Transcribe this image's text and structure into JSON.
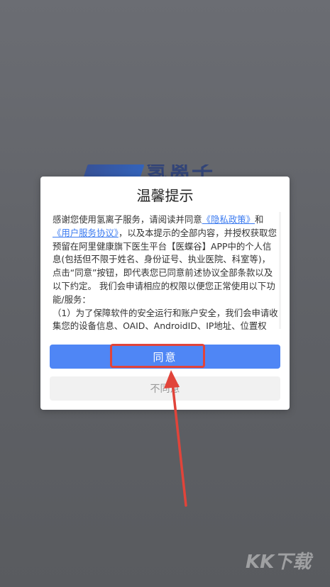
{
  "background": {
    "logo_text": "氢离子"
  },
  "dialog": {
    "title": "温馨提示",
    "body": {
      "line1_prefix": "感谢您使用氢离子服务，请阅读并同意",
      "privacy_link": "《隐私政策》",
      "and": "和",
      "user_agreement_link": "《用户服务协议》",
      "rest": "，以及本提示的全部内容，并授权获取您预留在阿里健康旗下医生平台【医蝶谷】APP中的个人信息(包括但不限于姓名、身份证号、执业医院、科室等)，点击“同意”按钮，即代表您已同意前述协议全部条款以及以下约定。 我们会申请相应的权限以便您正常使用以下功能/服务：",
      "item1": "（1）为了保障软件的安全运行和账户安全，我们会申请收集您的设备信息、OAID、AndroidID、IP地址、位置权"
    },
    "agree_label": "同意",
    "disagree_label": "不同意"
  },
  "annotation": {
    "highlight_color": "#e1443a"
  },
  "watermark": {
    "text": "KK下载"
  },
  "colors": {
    "primary_button": "#4f86f5",
    "link": "#3b7bf0",
    "disabled_button": "#f1f1f1"
  }
}
